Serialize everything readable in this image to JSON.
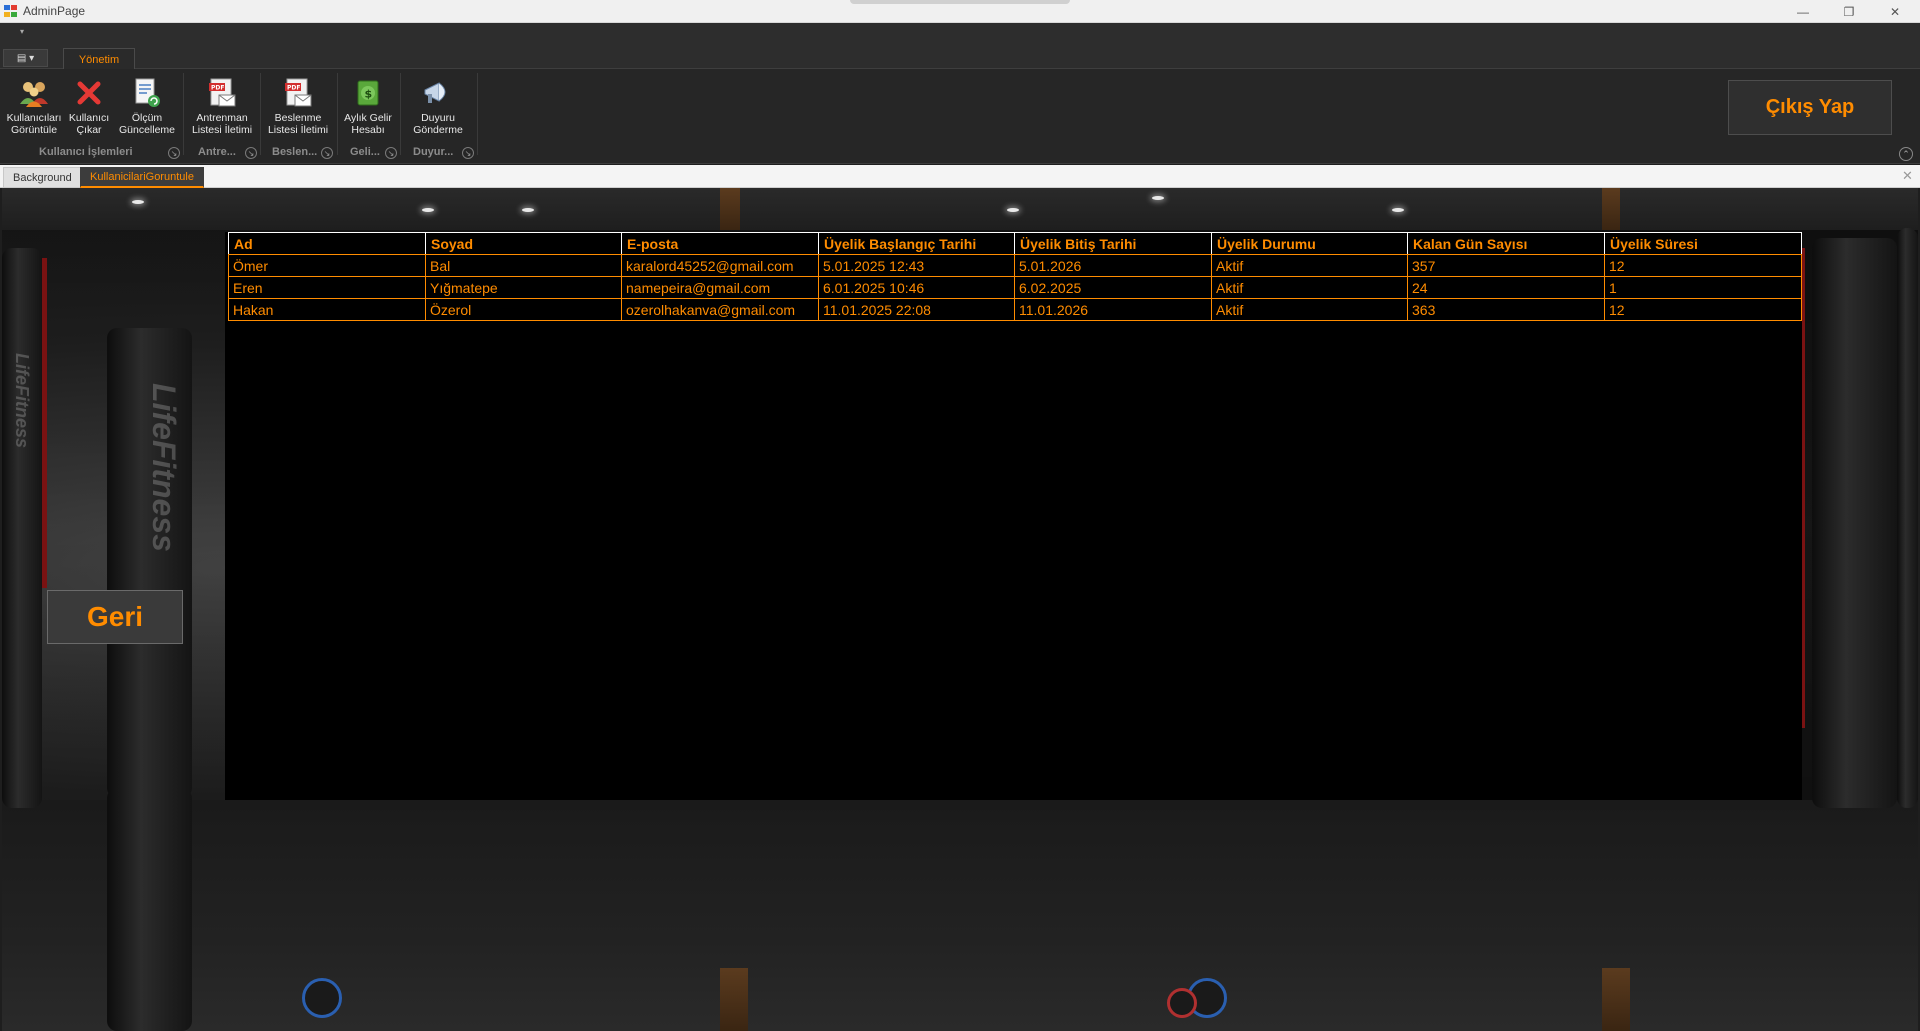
{
  "window": {
    "title": "AdminPage",
    "minimize_glyph": "—",
    "restore_glyph": "❐",
    "close_glyph": "✕"
  },
  "ribbon": {
    "qat_glyph": "▾",
    "app_menu_glyph": "▤ ▾",
    "active_tab": "Yönetim",
    "buttons": [
      {
        "id": "users",
        "line1": "Kullanıcıları",
        "line2": "Görüntüle",
        "icon": "users-icon"
      },
      {
        "id": "remove",
        "line1": "Kullanıcı",
        "line2": "Çıkar",
        "icon": "red-x-icon"
      },
      {
        "id": "measure",
        "line1": "Ölçüm",
        "line2": "Güncelleme",
        "icon": "document-refresh-icon"
      },
      {
        "id": "training",
        "line1": "Antrenman",
        "line2": "Listesi İletimi",
        "icon": "pdf-mail-icon"
      },
      {
        "id": "nutrition",
        "line1": "Beslenme",
        "line2": "Listesi İletimi",
        "icon": "pdf-mail-icon"
      },
      {
        "id": "income",
        "line1": "Aylık Gelir",
        "line2": "Hesabı",
        "icon": "money-icon"
      },
      {
        "id": "announce",
        "line1": "Duyuru",
        "line2": "Gönderme",
        "icon": "megaphone-icon"
      }
    ],
    "groups": [
      "Kullanıcı İşlemleri",
      "Antre...",
      "Beslen...",
      "Geli...",
      "Duyur..."
    ],
    "launcher_glyph": "↘",
    "collapse_glyph": "⌃",
    "logout_label": "Çıkış Yap"
  },
  "doc_tabs": {
    "tabs": [
      "Background",
      "KullanicilariGoruntule"
    ],
    "active": "KullanicilariGoruntule",
    "close_glyph": "✕"
  },
  "content": {
    "back_label": "Geri",
    "background_brand": "LifeFitness",
    "table": {
      "columns": [
        "Ad",
        "Soyad",
        "E-posta",
        "Üyelik Başlangıç Tarihi",
        "Üyelik Bitiş Tarihi",
        "Üyelik Durumu",
        "Kalan Gün Sayısı",
        "Üyelik Süresi"
      ],
      "rows": [
        [
          "Ömer",
          "Bal",
          "karalord45252@gmail.com",
          "5.01.2025 12:43",
          "5.01.2026",
          "Aktif",
          "357",
          "12"
        ],
        [
          "Eren",
          "Yığmatepe",
          "namepeira@gmail.com",
          "6.01.2025 10:46",
          "6.02.2025",
          "Aktif",
          "24",
          "1"
        ],
        [
          "Hakan",
          "Özerol",
          "ozerolhakanva@gmail.com",
          "11.01.2025 22:08",
          "11.01.2026",
          "Aktif",
          "363",
          "12"
        ]
      ]
    }
  },
  "colors": {
    "accent": "#ff8c00",
    "ribbon_bg": "#262626",
    "grid_bg": "#000000"
  }
}
